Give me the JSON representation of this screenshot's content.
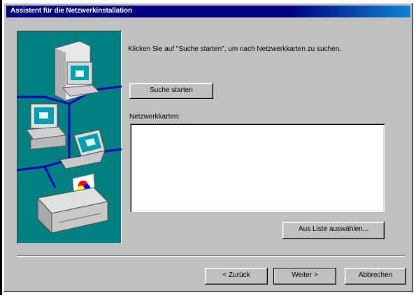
{
  "window": {
    "title": "Assistent für die Netzwerkinstallation"
  },
  "main": {
    "instruction": "Klicken Sie auf \"Suche starten\", um nach Netzwerkkarten zu suchen.",
    "search_button": "Suche starten",
    "list_label": "Netzwerkkarten:",
    "list_items": [],
    "select_from_list_button": "Aus Liste auswählen..."
  },
  "footer": {
    "back_button": "< Zurück",
    "next_button": "Weiter >",
    "cancel_button": "Abbrechen"
  },
  "icons": [
    "computer-icon",
    "computer-icon",
    "laptop-icon",
    "printer-icon",
    "network-cable"
  ]
}
